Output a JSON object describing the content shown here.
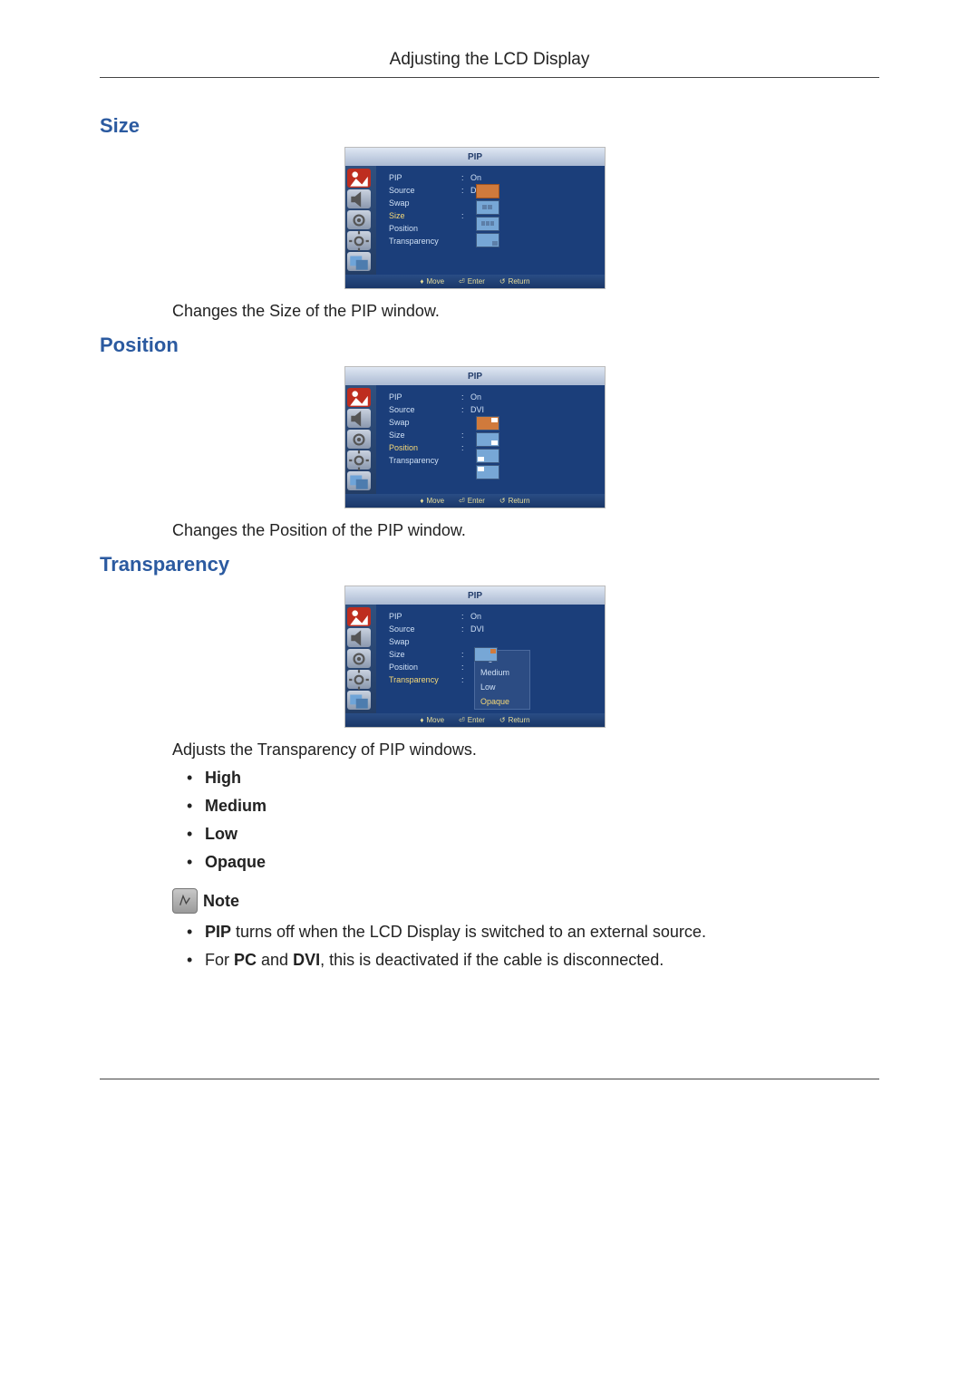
{
  "header": {
    "title": "Adjusting the LCD Display"
  },
  "sections": {
    "size": {
      "heading": "Size",
      "desc": "Changes the Size of the PIP window."
    },
    "position": {
      "heading": "Position",
      "desc": "Changes the Position of the PIP window."
    },
    "transparency": {
      "heading": "Transparency",
      "desc": "Adjusts the Transparency of PIP windows.",
      "options": [
        "High",
        "Medium",
        "Low",
        "Opaque"
      ]
    }
  },
  "note": {
    "label": "Note",
    "items": [
      {
        "bold1": "PIP",
        "rest": " turns off when the LCD Display is switched to an external source."
      },
      {
        "pre": "For ",
        "b1": "PC",
        "mid": " and ",
        "b2": "DVI",
        "post": ", this is deactivated if the cable is disconnected."
      }
    ]
  },
  "osd": {
    "title": "PIP",
    "labels": [
      "PIP",
      "Source",
      "Swap",
      "Size",
      "Position",
      "Transparency"
    ],
    "values": {
      "pip": "On",
      "source": "DVI"
    },
    "transparency_options": [
      "High",
      "Medium",
      "Low",
      "Opaque"
    ],
    "footer": {
      "move": "Move",
      "enter": "Enter",
      "return": "Return"
    }
  }
}
